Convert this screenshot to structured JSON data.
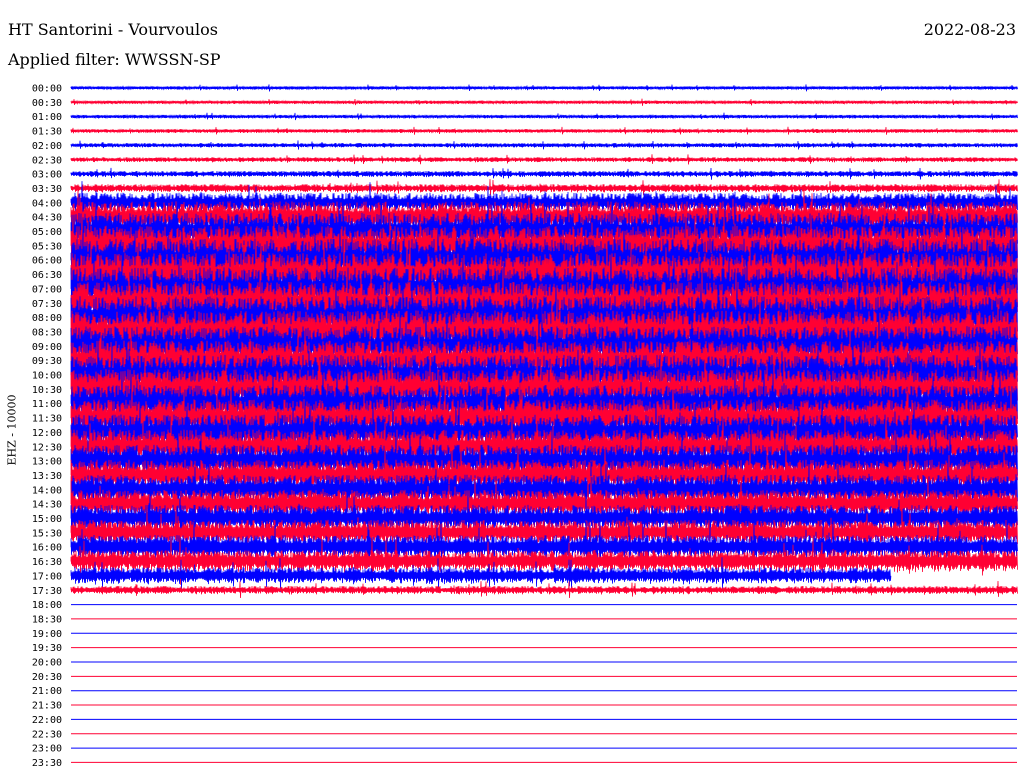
{
  "header": {
    "station": "HT Santorini - Vourvoulos",
    "date": "2022-08-23",
    "filter": "Applied filter: WWSSN-SP"
  },
  "chart_data": {
    "type": "line",
    "title": "HT Santorini - Vourvoulos",
    "ylabel": "EHZ - 10000",
    "date": "2022-08-23",
    "filter": "WWSSN-SP",
    "row_colors": [
      "#0000ff",
      "#ff0033"
    ],
    "rows": [
      "00:00",
      "00:30",
      "01:00",
      "01:30",
      "02:00",
      "02:30",
      "03:00",
      "03:30",
      "04:00",
      "04:30",
      "05:00",
      "05:30",
      "06:00",
      "06:30",
      "07:00",
      "07:30",
      "08:00",
      "08:30",
      "09:00",
      "09:30",
      "10:00",
      "10:30",
      "11:00",
      "11:30",
      "12:00",
      "12:30",
      "13:00",
      "13:30",
      "14:00",
      "14:30",
      "15:00",
      "15:30",
      "16:00",
      "16:30",
      "17:00",
      "17:30",
      "18:00",
      "18:30",
      "19:00",
      "19:30",
      "20:00",
      "20:30",
      "21:00",
      "21:30",
      "22:00",
      "22:30",
      "23:00",
      "23:30"
    ],
    "amplitude": [
      0.12,
      0.12,
      0.13,
      0.14,
      0.16,
      0.18,
      0.22,
      0.3,
      0.7,
      1.1,
      1.3,
      1.4,
      1.5,
      1.5,
      1.5,
      1.5,
      1.5,
      1.5,
      1.4,
      1.4,
      1.4,
      1.4,
      1.3,
      1.3,
      1.25,
      1.2,
      1.15,
      1.1,
      1.05,
      1.0,
      0.95,
      0.9,
      0.85,
      0.8,
      0.6,
      0.3,
      0,
      0,
      0,
      0,
      0,
      0,
      0,
      0,
      0,
      0,
      0,
      0
    ],
    "recorded_until": "17:26"
  }
}
